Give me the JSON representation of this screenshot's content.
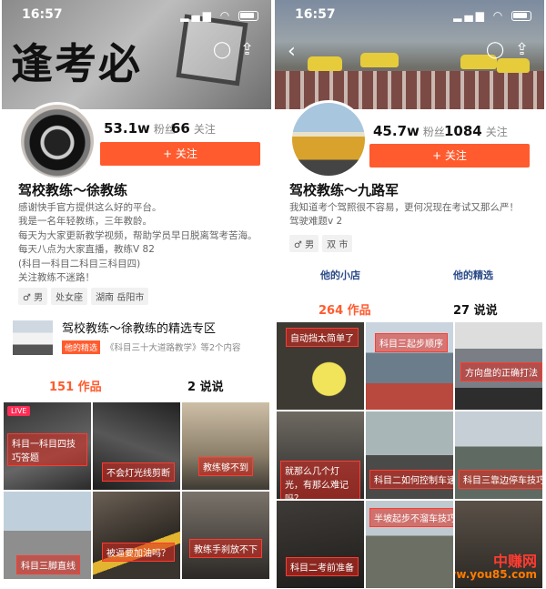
{
  "left": {
    "status": {
      "time": "16:57"
    },
    "cover_text": "逢考必",
    "stats": {
      "followers_value": "53.1w",
      "followers_label": "粉丝",
      "following_value": "66",
      "following_label": "关注"
    },
    "follow_label": "+ 关注",
    "name": "驾校教练～徐教练",
    "bio": [
      "感谢快手官方提供这么好的平台。",
      "我是一名年轻教练，三年教龄。",
      "每天为大家更新教学视频，帮助学员早日脱离驾考苦海。",
      "每天八点为大家直播，教练V          82",
      "(科目一科目二科目三科目四)",
      "关注教练不迷路！"
    ],
    "tags": [
      "♂ 男",
      "处女座",
      "湖南 岳阳市"
    ],
    "feature": {
      "title": "驾校教练～徐教练的精选专区",
      "badge": "他的精选",
      "subtitle": "《科目三十大道路教学》等2个内容"
    },
    "tabs": {
      "works": "151 作品",
      "says": "2 说说"
    },
    "tiles": [
      {
        "caption": "科目一科目四技巧答题",
        "live": "LIVE"
      },
      {
        "caption": "不会灯光线剪断"
      },
      {
        "caption": "教练够不到"
      },
      {
        "caption": "科目三脚直线"
      },
      {
        "caption": "被逼要加油吗？"
      },
      {
        "caption": "教练手刹放不下"
      }
    ]
  },
  "right": {
    "status": {
      "time": "16:57"
    },
    "stats": {
      "followers_value": "45.7w",
      "followers_label": "粉丝",
      "following_value": "1084",
      "following_label": "关注"
    },
    "follow_label": "+ 关注",
    "name": "驾校教练～九路军",
    "bio": [
      "我知道考个驾照很不容易，更何况现在考试又那么严！",
      "驾驶难题v                    2"
    ],
    "tags": [
      "♂ 男",
      "双                  市"
    ],
    "links": {
      "shop": "他的小店",
      "picks": "他的精选"
    },
    "tabs": {
      "works": "264 作品",
      "says": "27 说说"
    },
    "tiles": [
      {
        "caption": "自动挡太简单了"
      },
      {
        "caption": "科目三起步顺序"
      },
      {
        "caption": "方向盘的正确打法"
      },
      {
        "caption": "就那么几个灯光，有那么难记吗？"
      },
      {
        "caption": "科目二如何控制车速"
      },
      {
        "caption": "科目三靠边停车技巧"
      },
      {
        "caption": "科目二考前准备"
      },
      {
        "caption": "半坡起步不溜车技巧"
      },
      {
        "caption": ""
      }
    ],
    "watermark": {
      "name": "中赚网",
      "url": "www.you85.com"
    }
  }
}
